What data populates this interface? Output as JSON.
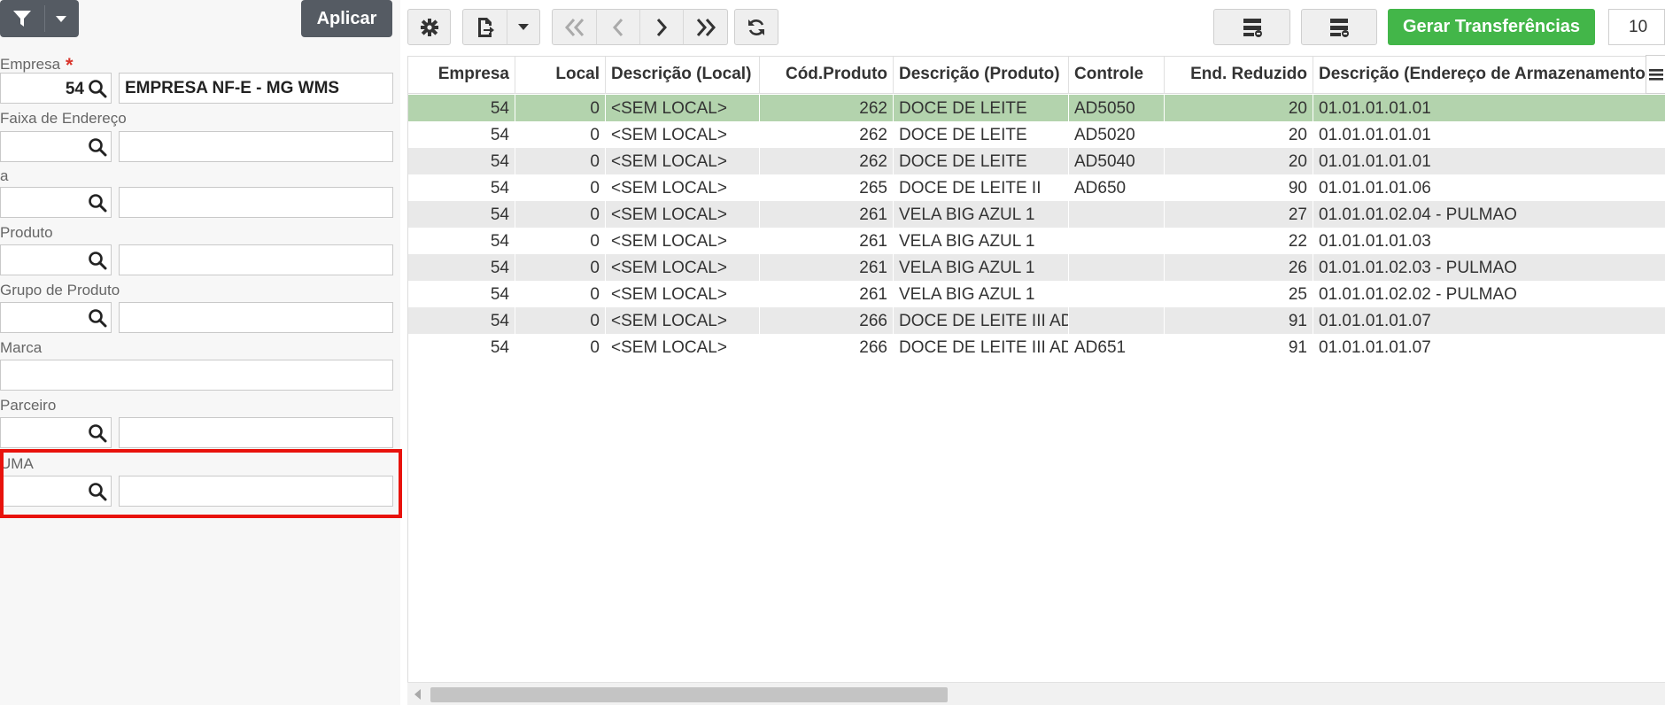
{
  "filters": {
    "apply_label": "Aplicar",
    "empresa": {
      "label": "Empresa",
      "required_mark": "*",
      "code": "54",
      "description": "EMPRESA NF-E - MG WMS"
    },
    "faixa_endereco": {
      "label": "Faixa de Endereço",
      "code": "",
      "description": ""
    },
    "faixa_ate": {
      "label": "a",
      "code": "",
      "description": ""
    },
    "produto": {
      "label": "Produto",
      "code": "",
      "description": ""
    },
    "grupo_produto": {
      "label": "Grupo de Produto",
      "code": "",
      "description": ""
    },
    "marca": {
      "label": "Marca",
      "value": ""
    },
    "parceiro": {
      "label": "Parceiro",
      "code": "",
      "description": ""
    },
    "uma": {
      "label": "UMA",
      "code": "",
      "description": ""
    }
  },
  "toolbar": {
    "generate_label": "Gerar Transferências",
    "page_size": "10",
    "icons": [
      "gear-icon",
      "export-icon",
      "caret-down-icon",
      "first-page-icon",
      "prev-page-icon",
      "next-page-icon",
      "last-page-icon",
      "refresh-icon",
      "layout-icon",
      "layout-icon",
      "menu-icon"
    ]
  },
  "grid": {
    "columns": [
      "Empresa",
      "Local",
      "Descrição (Local)",
      "Cód.Produto",
      "Descrição (Produto)",
      "Controle",
      "End. Reduzido",
      "Descrição (Endereço de Armazenamento)"
    ],
    "rows": [
      [
        "54",
        "0",
        "<SEM LOCAL>",
        "262",
        "DOCE DE LEITE",
        "AD5050",
        "20",
        "01.01.01.01.01"
      ],
      [
        "54",
        "0",
        "<SEM LOCAL>",
        "262",
        "DOCE DE LEITE",
        "AD5020",
        "20",
        "01.01.01.01.01"
      ],
      [
        "54",
        "0",
        "<SEM LOCAL>",
        "262",
        "DOCE DE LEITE",
        "AD5040",
        "20",
        "01.01.01.01.01"
      ],
      [
        "54",
        "0",
        "<SEM LOCAL>",
        "265",
        "DOCE DE LEITE II",
        "AD650",
        "90",
        "01.01.01.01.06"
      ],
      [
        "54",
        "0",
        "<SEM LOCAL>",
        "261",
        "VELA BIG AZUL 1",
        "",
        "27",
        "01.01.01.02.04 - PULMAO"
      ],
      [
        "54",
        "0",
        "<SEM LOCAL>",
        "261",
        "VELA BIG AZUL 1",
        "",
        "22",
        "01.01.01.01.03"
      ],
      [
        "54",
        "0",
        "<SEM LOCAL>",
        "261",
        "VELA BIG AZUL 1",
        "",
        "26",
        "01.01.01.02.03 - PULMAO"
      ],
      [
        "54",
        "0",
        "<SEM LOCAL>",
        "261",
        "VELA BIG AZUL 1",
        "",
        "25",
        "01.01.01.02.02 - PULMAO"
      ],
      [
        "54",
        "0",
        "<SEM LOCAL>",
        "266",
        "DOCE DE LEITE III AD",
        "",
        "91",
        "01.01.01.01.07"
      ],
      [
        "54",
        "0",
        "<SEM LOCAL>",
        "266",
        "DOCE DE LEITE III AD",
        "AD651",
        "91",
        "01.01.01.01.07"
      ]
    ],
    "selected_row": 0
  },
  "colors": {
    "accent_green": "#43b649",
    "selected_row": "#b3d3ad",
    "highlight_red": "#e8120c",
    "dark_button": "#555b63"
  }
}
